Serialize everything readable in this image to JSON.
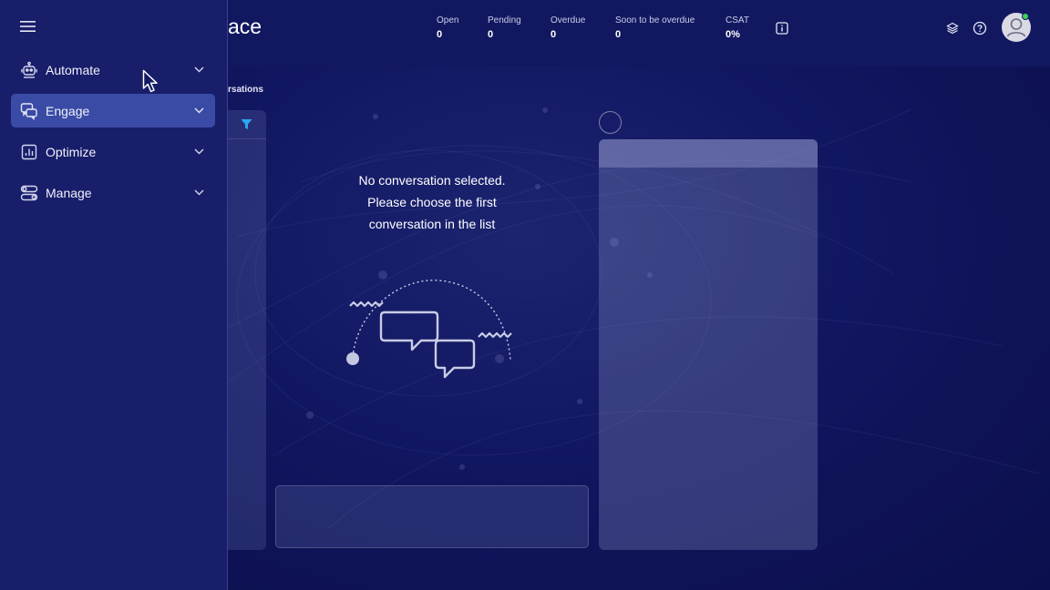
{
  "header": {
    "app_title": "ace",
    "stats": [
      {
        "label": "Open",
        "value": "0"
      },
      {
        "label": "Pending",
        "value": "0"
      },
      {
        "label": "Overdue",
        "value": "0"
      },
      {
        "label": "Soon to be overdue",
        "value": "0"
      },
      {
        "label": "CSAT",
        "value": "0%"
      }
    ],
    "icons": [
      "info-icon",
      "layers-icon",
      "help-icon",
      "avatar-icon"
    ],
    "status_color": "#3fcf5a"
  },
  "breadcrumb": "rsations",
  "sidebar": {
    "items": [
      {
        "label": "Automate",
        "icon": "robot-icon",
        "active": false
      },
      {
        "label": "Engage",
        "icon": "chat-icon",
        "active": true
      },
      {
        "label": "Optimize",
        "icon": "chart-icon",
        "active": false
      },
      {
        "label": "Manage",
        "icon": "toggles-icon",
        "active": false
      }
    ],
    "active_color": "#3a4ba6"
  },
  "empty_state": {
    "line1": "No conversation selected.",
    "line2": "Please choose the first",
    "line3": "conversation in the list"
  },
  "accent": "#29a8f0"
}
